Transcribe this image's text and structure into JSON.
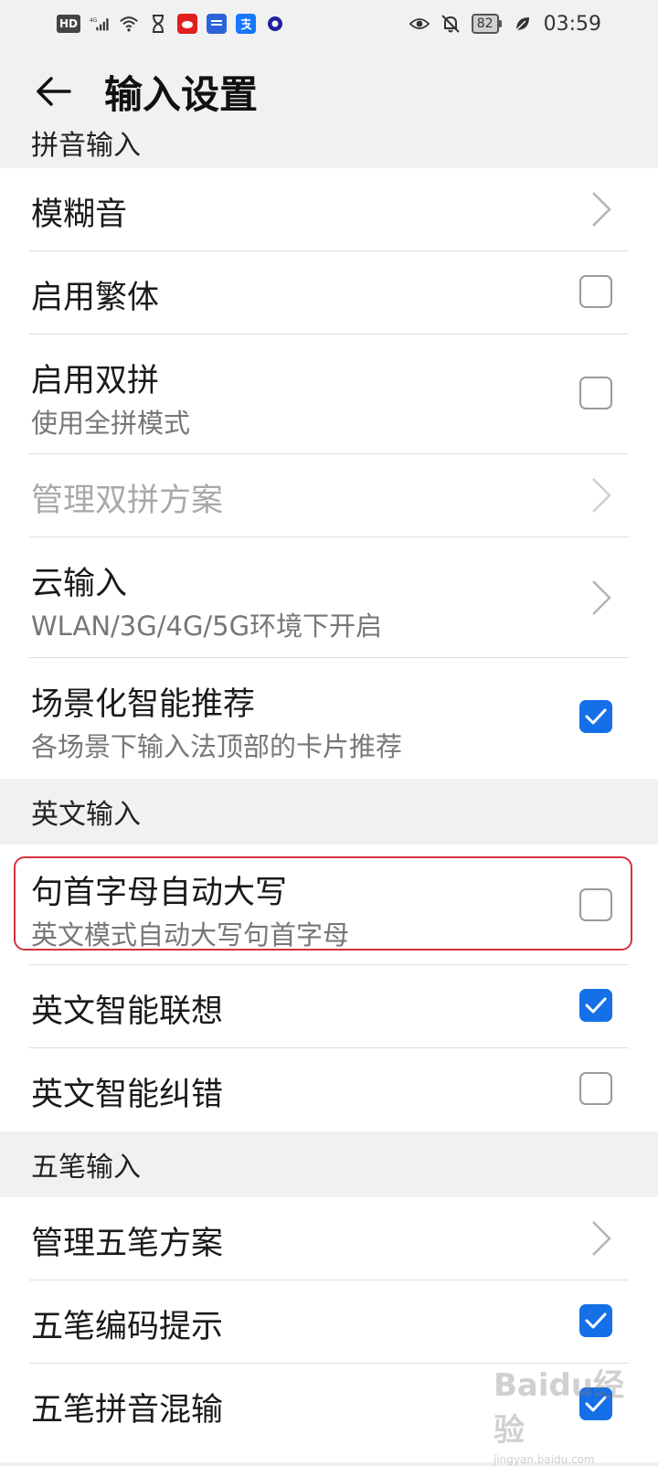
{
  "status_bar": {
    "hd_badge": "HD",
    "network": "4G",
    "battery": "82",
    "time": "03:59",
    "app_icons": [
      "sina-icon",
      "news-app-icon",
      "alipay-icon",
      "browser-icon"
    ]
  },
  "header": {
    "title": "输入设置",
    "back_icon": "arrow-left-icon"
  },
  "sections": [
    {
      "header": "拼音输入",
      "items": [
        {
          "title": "模糊音",
          "control": "chevron"
        },
        {
          "title": "启用繁体",
          "control": "checkbox",
          "checked": false
        },
        {
          "title": "启用双拼",
          "subtitle": "使用全拼模式",
          "control": "checkbox",
          "checked": false
        },
        {
          "title": "管理双拼方案",
          "control": "chevron",
          "disabled": true
        },
        {
          "title": "云输入",
          "subtitle": "WLAN/3G/4G/5G环境下开启",
          "control": "chevron"
        },
        {
          "title": "场景化智能推荐",
          "subtitle": "各场景下输入法顶部的卡片推荐",
          "control": "checkbox",
          "checked": true
        }
      ]
    },
    {
      "header": "英文输入",
      "items": [
        {
          "title": "句首字母自动大写",
          "subtitle": "英文模式自动大写句首字母",
          "control": "checkbox",
          "checked": false,
          "highlighted": true
        },
        {
          "title": "英文智能联想",
          "control": "checkbox",
          "checked": true
        },
        {
          "title": "英文智能纠错",
          "control": "checkbox",
          "checked": false
        }
      ]
    },
    {
      "header": "五笔输入",
      "items": [
        {
          "title": "管理五笔方案",
          "control": "chevron"
        },
        {
          "title": "五笔编码提示",
          "control": "checkbox",
          "checked": true
        },
        {
          "title": "五笔拼音混输",
          "control": "checkbox",
          "checked": true
        }
      ]
    }
  ],
  "colors": {
    "accent": "#1570e8",
    "highlight_border": "#d3323c",
    "background": "#f1f1f1"
  },
  "watermark": {
    "text": "Baidu经验",
    "sub": "jingyan.baidu.com"
  }
}
